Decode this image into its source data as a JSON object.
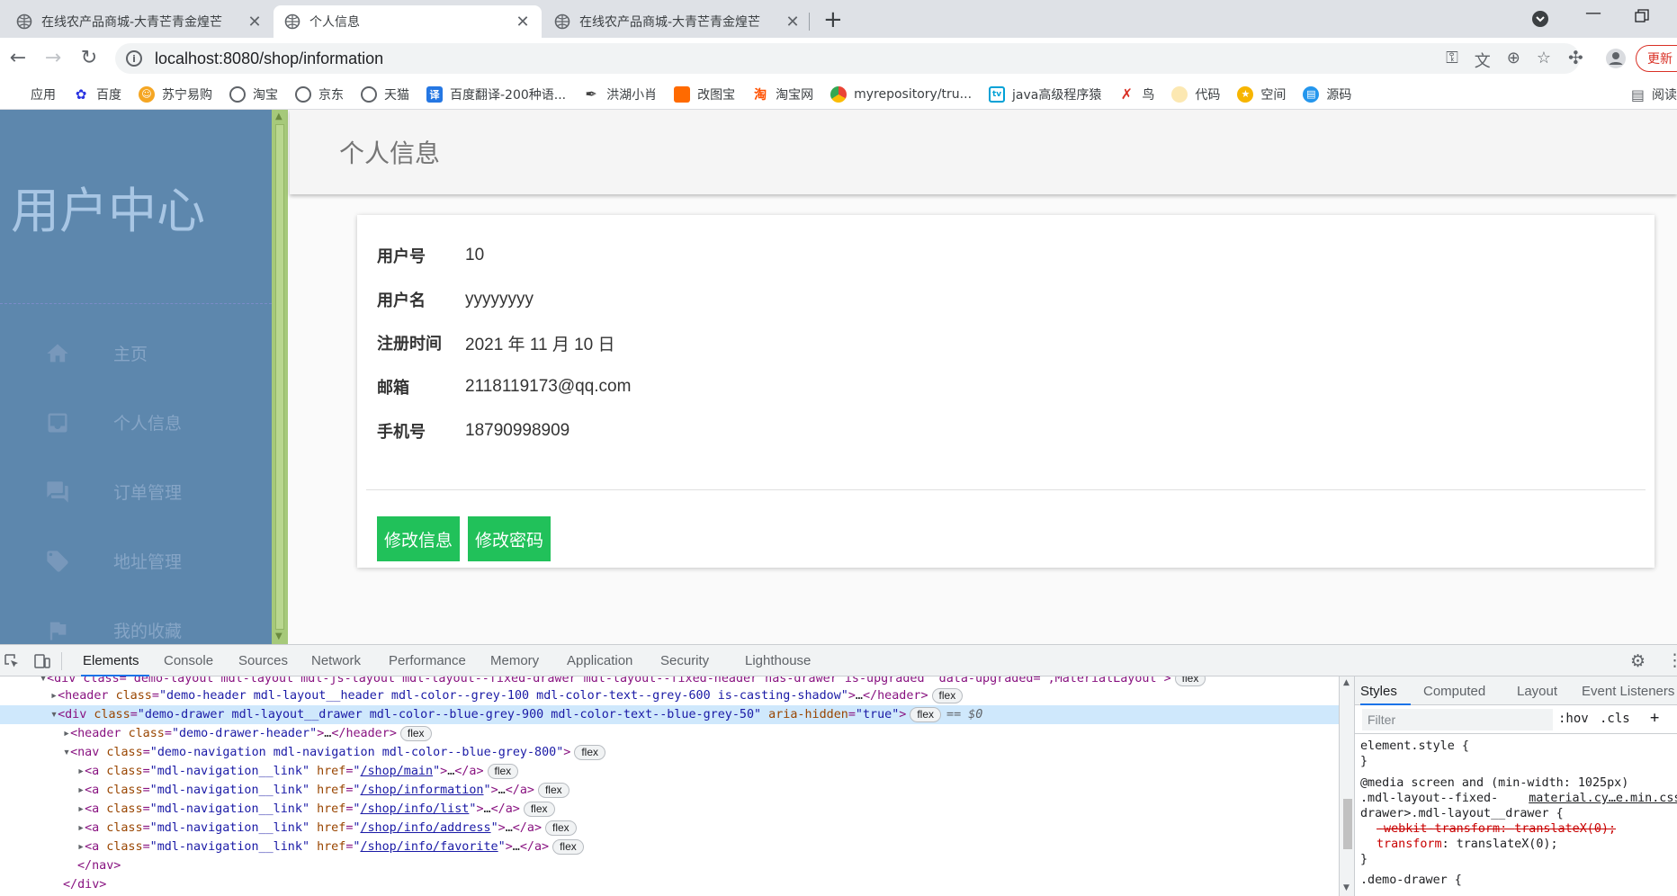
{
  "tabs": [
    {
      "title": "在线农产品商城-大青芒青金煌芒",
      "active": false
    },
    {
      "title": "个人信息",
      "active": true
    },
    {
      "title": "在线农产品商城-大青芒青金煌芒",
      "active": false
    }
  ],
  "toolbar": {
    "url": "localhost:8080/shop/information",
    "update_label": "更新"
  },
  "bookmarks": [
    {
      "label": "应用",
      "icon": "apps-grid-icon"
    },
    {
      "label": "百度",
      "icon": "baidu-icon"
    },
    {
      "label": "苏宁易购",
      "icon": "suning-icon"
    },
    {
      "label": "淘宝",
      "icon": "globe-icon"
    },
    {
      "label": "京东",
      "icon": "globe-icon"
    },
    {
      "label": "天猫",
      "icon": "globe-icon"
    },
    {
      "label": "百度翻译-200种语...",
      "icon": "translate-icon"
    },
    {
      "label": "洪湖小肖",
      "icon": "feather-icon"
    },
    {
      "label": "改图宝",
      "icon": "orange-square-icon"
    },
    {
      "label": "淘宝网",
      "icon": "taobao-icon"
    },
    {
      "label": "myrepository/tru...",
      "icon": "chrome-icon"
    },
    {
      "label": "java高级程序猿",
      "icon": "bilibili-icon"
    },
    {
      "label": "鸟",
      "icon": "bird-icon"
    },
    {
      "label": "代码",
      "icon": "code-icon"
    },
    {
      "label": "空间",
      "icon": "qzone-icon"
    },
    {
      "label": "源码",
      "icon": "docker-icon"
    }
  ],
  "bookmarks_reading": "阅读",
  "drawer": {
    "title": "用户中心",
    "items": [
      {
        "label": "主页",
        "icon": "home-icon"
      },
      {
        "label": "个人信息",
        "icon": "inbox-icon"
      },
      {
        "label": "订单管理",
        "icon": "forum-icon"
      },
      {
        "label": "地址管理",
        "icon": "tag-icon"
      },
      {
        "label": "我的收藏",
        "icon": "flag-icon"
      }
    ]
  },
  "page": {
    "header_title": "个人信息",
    "fields": [
      {
        "label": "用户号",
        "value": "10"
      },
      {
        "label": "用户名",
        "value": "yyyyyyyy"
      },
      {
        "label": "注册时间",
        "value": "2021 年 11 月 10 日"
      },
      {
        "label": "邮箱",
        "value": "2118119173@qq.com"
      },
      {
        "label": "手机号",
        "value": "18790998909"
      }
    ],
    "edit_info_label": "修改信息",
    "change_password_label": "修改密码"
  },
  "devtools": {
    "tabs": [
      "Elements",
      "Console",
      "Sources",
      "Network",
      "Performance",
      "Memory",
      "Application",
      "Security",
      "Lighthouse"
    ],
    "flex_badge": "flex",
    "eq0": "== $0",
    "dom": {
      "line0_prefix": "<div class=\"demo-layout mdl-layout mdl-js-layout mdl-layout--fixed-drawer mdl-layout--fixed-header has-drawer is-upgraded\" data-upgraded=\",MaterialLayout\">",
      "line1_tag": "header",
      "line1_class": "demo-header mdl-layout__header mdl-color--grey-100 mdl-color-text--grey-600 is-casting-shadow",
      "line2_tag": "div",
      "line2_class": "demo-drawer mdl-layout__drawer mdl-color--blue-grey-900 mdl-color-text--blue-grey-50",
      "line2_aria": "true",
      "line3_tag": "header",
      "line3_class": "demo-drawer-header",
      "line4_tag": "nav",
      "line4_class": "demo-navigation mdl-navigation mdl-color--blue-grey-800",
      "link_tag": "a",
      "link_class": "mdl-navigation__link",
      "link_hrefs": [
        "/shop/main",
        "/shop/information",
        "/shop/info/list",
        "/shop/info/address",
        "/shop/info/favorite"
      ],
      "nav_close": "</nav>",
      "div_close": "</div>"
    },
    "styles_tabs": [
      "Styles",
      "Computed",
      "Layout",
      "Event Listeners"
    ],
    "filter_placeholder": "Filter",
    "hov_label": ":hov",
    "cls_label": ".cls",
    "styles_lines": {
      "l1": "element.style {",
      "l2": "}",
      "l3": "@media screen and (min-width: 1025px)",
      "l4a": ".mdl-layout--fixed-",
      "l4b": "material.cy…e.min.css",
      "l5": "drawer>.mdl-layout__drawer {",
      "l6_prop": "-webkit-transform",
      "l6_val": "translateX(0);",
      "l7_prop": "transform",
      "l7_val": "translateX(0);",
      "l8": "}",
      "l9": ".demo-drawer {"
    }
  }
}
